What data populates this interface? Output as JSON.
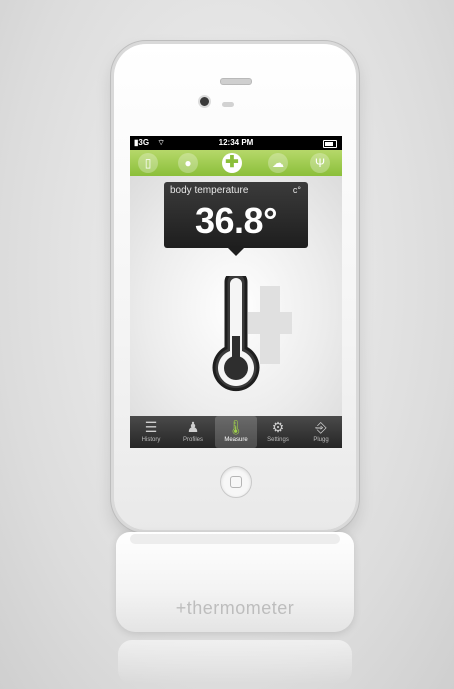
{
  "status_bar": {
    "signal": "3G",
    "time": "12:34 PM"
  },
  "category_bar": {
    "icons": [
      "bottle-icon",
      "drop-icon",
      "plus-icon",
      "cloud-icon",
      "utensils-icon"
    ],
    "active_index": 2
  },
  "reading": {
    "label": "body temperature",
    "unit": "c°",
    "value": "36.8°"
  },
  "tabs": [
    {
      "label": "History",
      "icon": "list-icon"
    },
    {
      "label": "Profiles",
      "icon": "person-icon"
    },
    {
      "label": "Measure",
      "icon": "thermometer-icon",
      "active": true
    },
    {
      "label": "Settings",
      "icon": "gear-icon"
    },
    {
      "label": "Plugg",
      "icon": "plug-icon"
    }
  ],
  "dock": {
    "label": "+thermometer"
  },
  "colors": {
    "accent_green": "#8bbf3a",
    "dark_panel": "#1e1e1e",
    "tabbar": "#2b2b2b"
  }
}
